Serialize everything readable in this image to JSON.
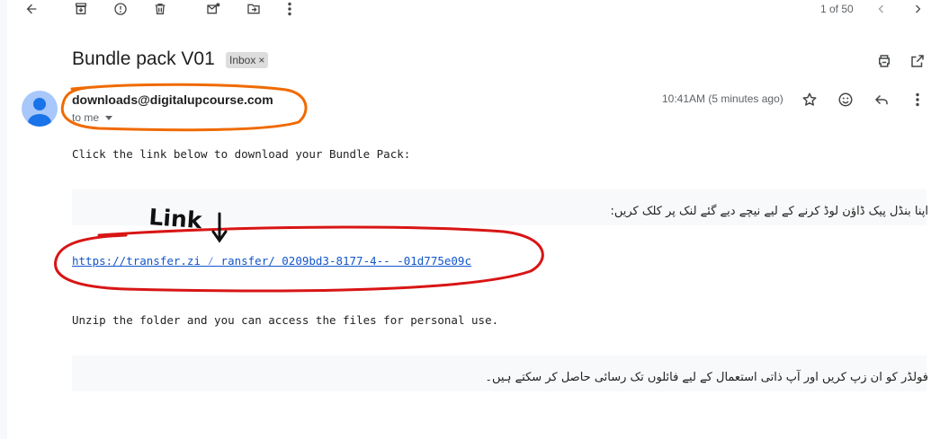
{
  "toolbar": {
    "icons": [
      "back-arrow-icon",
      "archive-icon",
      "report-spam-icon",
      "delete-icon",
      "mark-unread-icon",
      "move-to-icon",
      "more-vert-icon"
    ],
    "pager_text": "1 of 50"
  },
  "message": {
    "subject": "Bundle pack V01",
    "label": "Inbox",
    "label_remove": "×",
    "sender_email": "downloads@digitalupcourse.com",
    "recipient_text": "to me",
    "time": "10:41AM (5 minutes ago)"
  },
  "body": {
    "line1": "Click the link below to download your Bundle Pack:",
    "urdu1": "اپنا بنڈل پیک ڈاؤن لوڈ کرنے کے لیے نیچے دیے گئے لنک پر کلک کریں:",
    "link_text": "https://transfer.zi ⁄ ransfer/ 0209bd3-8177-4‐‐           ‐01d775e09c",
    "line3": "Unzip the folder and you can access the files for personal use.",
    "urdu3": "فولڈر کو ان زپ کریں اور آپ ذاتی استعمال کے لیے فائلوں تک رسائی حاصل کر سکتے ہیں۔"
  },
  "annotation": {
    "handwritten_label": "Link",
    "colors": {
      "orange_outline": "#f06a00",
      "red_outline": "#d81515",
      "ink": "#111111"
    }
  },
  "colors": {
    "link": "#1155cc",
    "avatar": "#a8c7fa",
    "avatar_figure": "#1a73e8",
    "band": "#f8f9fa"
  }
}
